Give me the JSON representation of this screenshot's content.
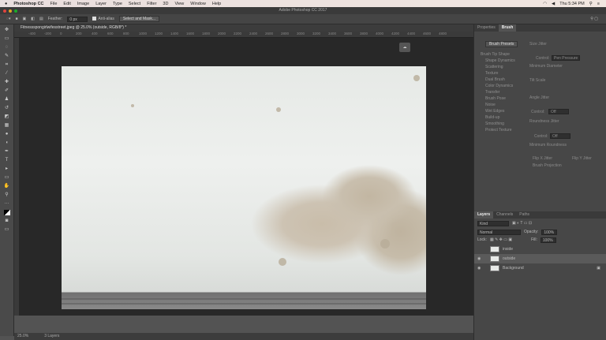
{
  "menubar": {
    "apple": "",
    "app": "Photoshop CC",
    "items": [
      "File",
      "Edit",
      "Image",
      "Layer",
      "Type",
      "Select",
      "Filter",
      "3D",
      "View",
      "Window",
      "Help"
    ],
    "clock": "Thu 5:34 PM"
  },
  "window": {
    "title": "Adobe Photoshop CC 2017"
  },
  "options": {
    "feather_label": "Feather:",
    "feather_value": "0 px",
    "antialias_label": "Anti-alias",
    "select_mask": "Select and Mask..."
  },
  "document": {
    "tab": "Fitnessspongirlwifesstreet.jpeg @ 25.0% (outside, RGB/8*) *"
  },
  "ruler": [
    "-400",
    "-200",
    "0",
    "200",
    "400",
    "600",
    "800",
    "1000",
    "1200",
    "1400",
    "1600",
    "1800",
    "2000",
    "2200",
    "2400",
    "2600",
    "2800",
    "3000",
    "3200",
    "3400",
    "3600",
    "3800",
    "4000",
    "4200",
    "4400",
    "4600",
    "4800"
  ],
  "status": {
    "zoom": "25.0%",
    "info": "3 Layers"
  },
  "brush_panel": {
    "tabs": [
      "Properties",
      "Brush"
    ],
    "presets_button": "Brush Presets",
    "options": [
      "Brush Tip Shape",
      "Shape Dynamics",
      "Scattering",
      "Texture",
      "Dual Brush",
      "Color Dynamics",
      "Transfer",
      "Brush Pose",
      "Noise",
      "Wet Edges",
      "Build-up",
      "Smoothing",
      "Protect Texture"
    ],
    "controls": [
      "Size Jitter",
      "Control:",
      "Pen Pressure",
      "Minimum Diameter",
      "Tilt Scale",
      "Angle Jitter",
      "Control:",
      "Off",
      "Roundness Jitter",
      "Control:",
      "Off",
      "Minimum Roundness",
      "Flip X Jitter",
      "Flip Y Jitter",
      "Brush Projection"
    ]
  },
  "layers_panel": {
    "tabs": [
      "Layers",
      "Channels",
      "Paths"
    ],
    "kind": "Kind",
    "blend": "Normal",
    "opacity_label": "Opacity:",
    "opacity": "100%",
    "lock_label": "Lock:",
    "fill_label": "Fill:",
    "fill": "100%",
    "layers": [
      {
        "name": "inside",
        "visible": false
      },
      {
        "name": "outside",
        "visible": true,
        "selected": true
      },
      {
        "name": "Background",
        "visible": true
      }
    ]
  }
}
